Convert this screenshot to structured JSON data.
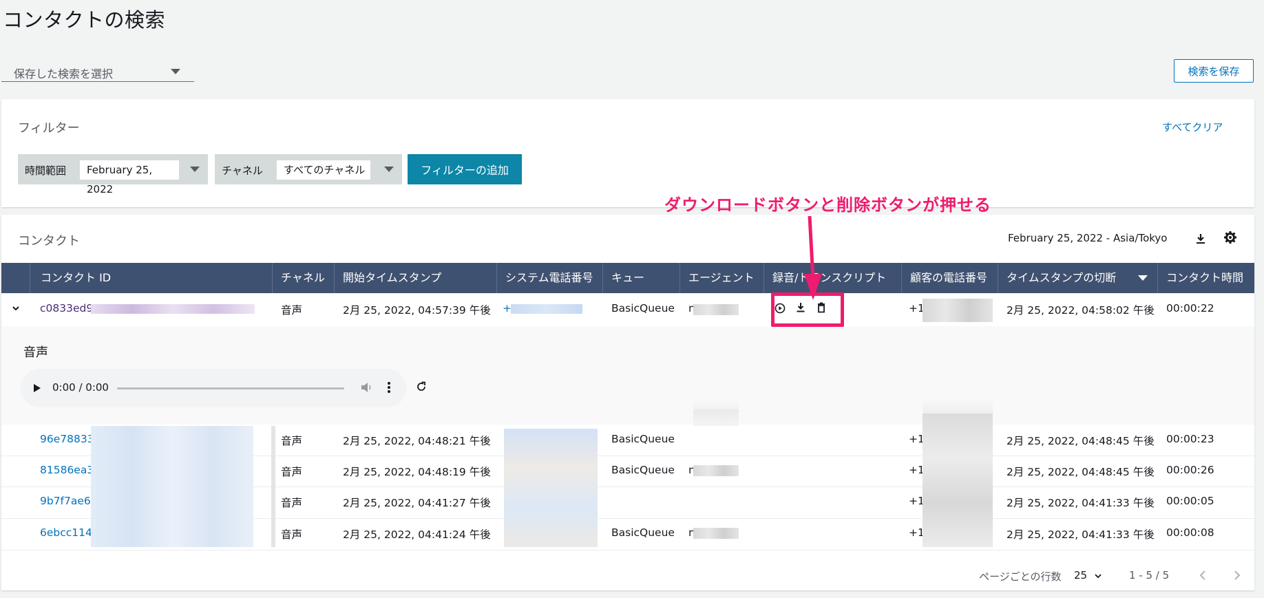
{
  "page_title": "コンタクトの検索",
  "saved_search": {
    "placeholder": "保存した検索を選択"
  },
  "save_search_button": "検索を保存",
  "filters": {
    "title": "フィルター",
    "clear_all": "すべてクリア",
    "chips": [
      {
        "key": "時間範囲",
        "value": "February 25, 2022"
      },
      {
        "key": "チャネル",
        "value": "すべてのチャネル"
      }
    ],
    "add_filter_button": "フィルターの追加"
  },
  "contacts": {
    "title": "コンタクト",
    "date_timezone": "February 25, 2022 - Asia/Tokyo",
    "columns": [
      "コンタクト ID",
      "チャネル",
      "開始タイムスタンプ",
      "システム電話番号",
      "キュー",
      "エージェント",
      "録音/トランスクリプト",
      "顧客の電話番号",
      "タイムスタンプの切断",
      "コンタクト時間"
    ],
    "rows": [
      {
        "id": "c0833ed9-",
        "channel": "音声",
        "start": "2月 25, 2022, 04:57:39 午後",
        "system_phone": "+",
        "queue": "BasicQueue",
        "agent": "n",
        "customer_phone": "+1",
        "disconnect": "2月 25, 2022, 04:58:02 午後",
        "duration": "00:00:22"
      },
      {
        "id": "96e78833-",
        "channel": "音声",
        "start": "2月 25, 2022, 04:48:21 午後",
        "system_phone": "",
        "queue": "BasicQueue",
        "agent": "",
        "customer_phone": "+1",
        "disconnect": "2月 25, 2022, 04:48:45 午後",
        "duration": "00:00:23"
      },
      {
        "id": "81586ea3-",
        "channel": "音声",
        "start": "2月 25, 2022, 04:48:19 午後",
        "system_phone": "",
        "queue": "BasicQueue",
        "agent": "n",
        "customer_phone": "+1",
        "disconnect": "2月 25, 2022, 04:48:45 午後",
        "duration": "00:00:26"
      },
      {
        "id": "9b7f7ae6-",
        "channel": "音声",
        "start": "2月 25, 2022, 04:41:27 午後",
        "system_phone": "",
        "queue": "",
        "agent": "",
        "customer_phone": "+1",
        "disconnect": "2月 25, 2022, 04:41:33 午後",
        "duration": "00:00:05"
      },
      {
        "id": "6ebcc114-",
        "channel": "音声",
        "start": "2月 25, 2022, 04:41:24 午後",
        "system_phone": "",
        "queue": "BasicQueue",
        "agent": "n",
        "customer_phone": "+1",
        "disconnect": "2月 25, 2022, 04:41:33 午後",
        "duration": "00:00:08"
      }
    ]
  },
  "audio": {
    "title": "音声",
    "time": "0:00 / 0:00"
  },
  "annotation": "ダウンロードボタンと削除ボタンが押せる",
  "pagination": {
    "rows_per_page_label": "ページごとの行数",
    "rows_per_page": "25",
    "range": "1 - 5 / 5"
  },
  "colors": {
    "header_bg": "#3f5170",
    "accent": "#0d86a8",
    "link": "#0073bb",
    "annotation": "#ee1c6e"
  }
}
